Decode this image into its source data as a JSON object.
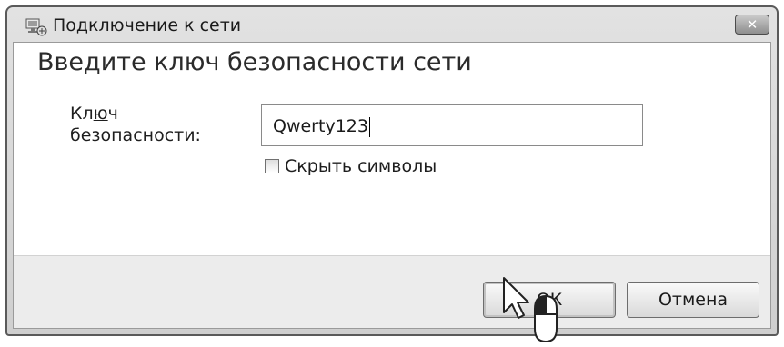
{
  "window": {
    "title": "Подключение к сети",
    "close_symbol": "✕",
    "icon": "network-connection-icon"
  },
  "main": {
    "heading": "Введите ключ безопасности сети",
    "key_label_prefix": "Кл",
    "key_label_underlined": "ю",
    "key_label_suffix": "ч\nбезопасности:",
    "key_value": "Qwerty123",
    "hide_chars_checked": false,
    "hide_chars_underlined": "С",
    "hide_chars_label": "крыть символы"
  },
  "buttons": {
    "ok_label": "ОК",
    "cancel_label": "Отмена"
  },
  "cursor": {
    "icon": "mouse-pointer-icon",
    "annotation": "mouse-click-icon"
  }
}
